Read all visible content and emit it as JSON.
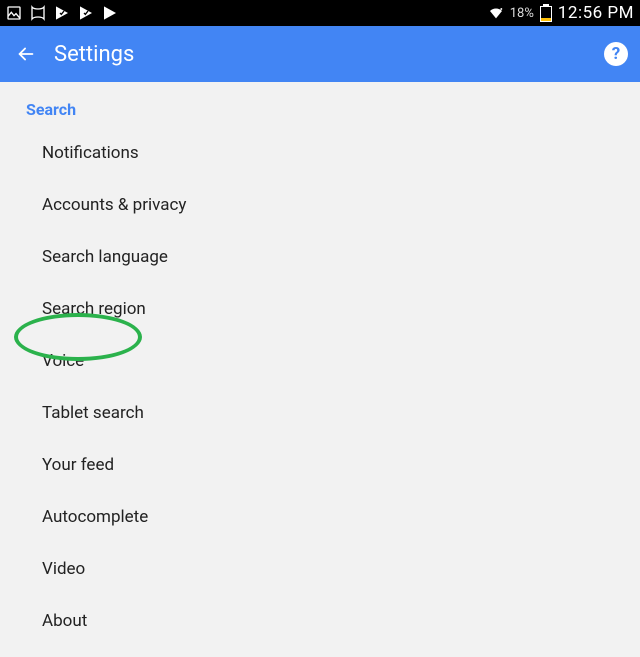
{
  "status_bar": {
    "battery_pct": "18%",
    "time": "12:56 PM",
    "left_icons": [
      "image-icon",
      "present-icon",
      "play-check-icon",
      "play-check-icon",
      "play-store-icon"
    ],
    "right_icons": [
      "wifi-icon"
    ]
  },
  "app_bar": {
    "title": "Settings",
    "help_glyph": "?"
  },
  "section": {
    "header": "Search",
    "items": [
      {
        "label": "Notifications"
      },
      {
        "label": "Accounts & privacy"
      },
      {
        "label": "Search language"
      },
      {
        "label": "Search region"
      },
      {
        "label": "Voice"
      },
      {
        "label": "Tablet search"
      },
      {
        "label": "Your feed"
      },
      {
        "label": "Autocomplete"
      },
      {
        "label": "Video"
      },
      {
        "label": "About"
      }
    ]
  },
  "annotation": {
    "highlighted_item_index": 4
  },
  "colors": {
    "primary": "#4285f4",
    "annotation": "#2bb24c",
    "battery_fill": "#ffc107"
  }
}
